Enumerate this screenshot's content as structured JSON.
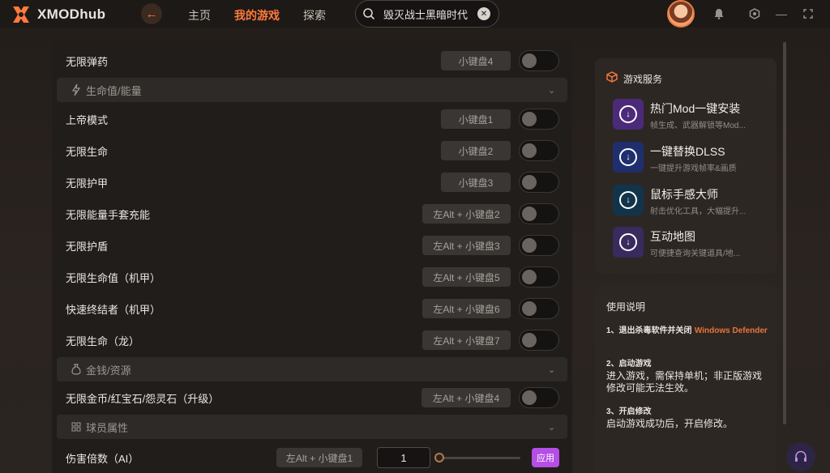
{
  "app": {
    "logo_text": "XMODhub"
  },
  "nav": {
    "items": [
      {
        "label": "主页",
        "active": false
      },
      {
        "label": "我的游戏",
        "active": true
      },
      {
        "label": "探索",
        "active": false
      }
    ]
  },
  "search": {
    "value": "毁灭战士黑暗时代"
  },
  "cheats": {
    "rows": [
      {
        "label": "无限弹药",
        "hotkey": "小键盘4"
      },
      {
        "section": "生命值/能量",
        "icon": "lightning-icon"
      },
      {
        "label": "上帝模式",
        "hotkey": "小键盘1"
      },
      {
        "label": "无限生命",
        "hotkey": "小键盘2"
      },
      {
        "label": "无限护甲",
        "hotkey": "小键盘3"
      },
      {
        "label": "无限能量手套充能",
        "hotkey": "左Alt + 小键盘2"
      },
      {
        "label": "无限护盾",
        "hotkey": "左Alt + 小键盘3"
      },
      {
        "label": "无限生命值（机甲）",
        "hotkey": "左Alt + 小键盘5"
      },
      {
        "label": "快速终结者（机甲）",
        "hotkey": "左Alt + 小键盘6"
      },
      {
        "label": "无限生命（龙）",
        "hotkey": "左Alt + 小键盘7"
      },
      {
        "section": "金钱/资源",
        "icon": "money-bag-icon"
      },
      {
        "label": "无限金币/红宝石/怨灵石（升级）",
        "hotkey": "左Alt + 小键盘4"
      },
      {
        "section": "球员属性",
        "icon": "grid-icon"
      },
      {
        "label": "伤害倍数（AI）",
        "hotkey": "左Alt + 小键盘1",
        "input_value": "1",
        "apply_label": "应用"
      }
    ]
  },
  "services": {
    "title": "游戏服务",
    "items": [
      {
        "title": "热门Mod一键安装",
        "subtitle": "帧生成、武器解锁等Mod..."
      },
      {
        "title": "一键替换DLSS",
        "subtitle": "一键提升游戏帧率&画质"
      },
      {
        "title": "鼠标手感大师",
        "subtitle": "射击优化工具，大幅提升..."
      },
      {
        "title": "互动地图",
        "subtitle": "可便捷查询关键道具/地..."
      }
    ]
  },
  "usage": {
    "title": "使用说明",
    "steps": [
      {
        "head": "1、退出杀毒软件并关闭",
        "accent": "Windows Defender"
      },
      {
        "head": "2、启动游戏",
        "body": "进入游戏，需保持单机；非正版游戏修改可能无法生效。"
      },
      {
        "head": "3、开启修改",
        "body": "启动游戏成功后，开启修改。"
      }
    ]
  },
  "colors": {
    "accent": "#ff7a3d",
    "apply_button": "#b44ee6",
    "svc_icon_1": "#4b2a7a",
    "svc_icon_2": "#1f2f6e",
    "svc_icon_3": "#12344a",
    "svc_icon_4": "#3a2a5e"
  }
}
